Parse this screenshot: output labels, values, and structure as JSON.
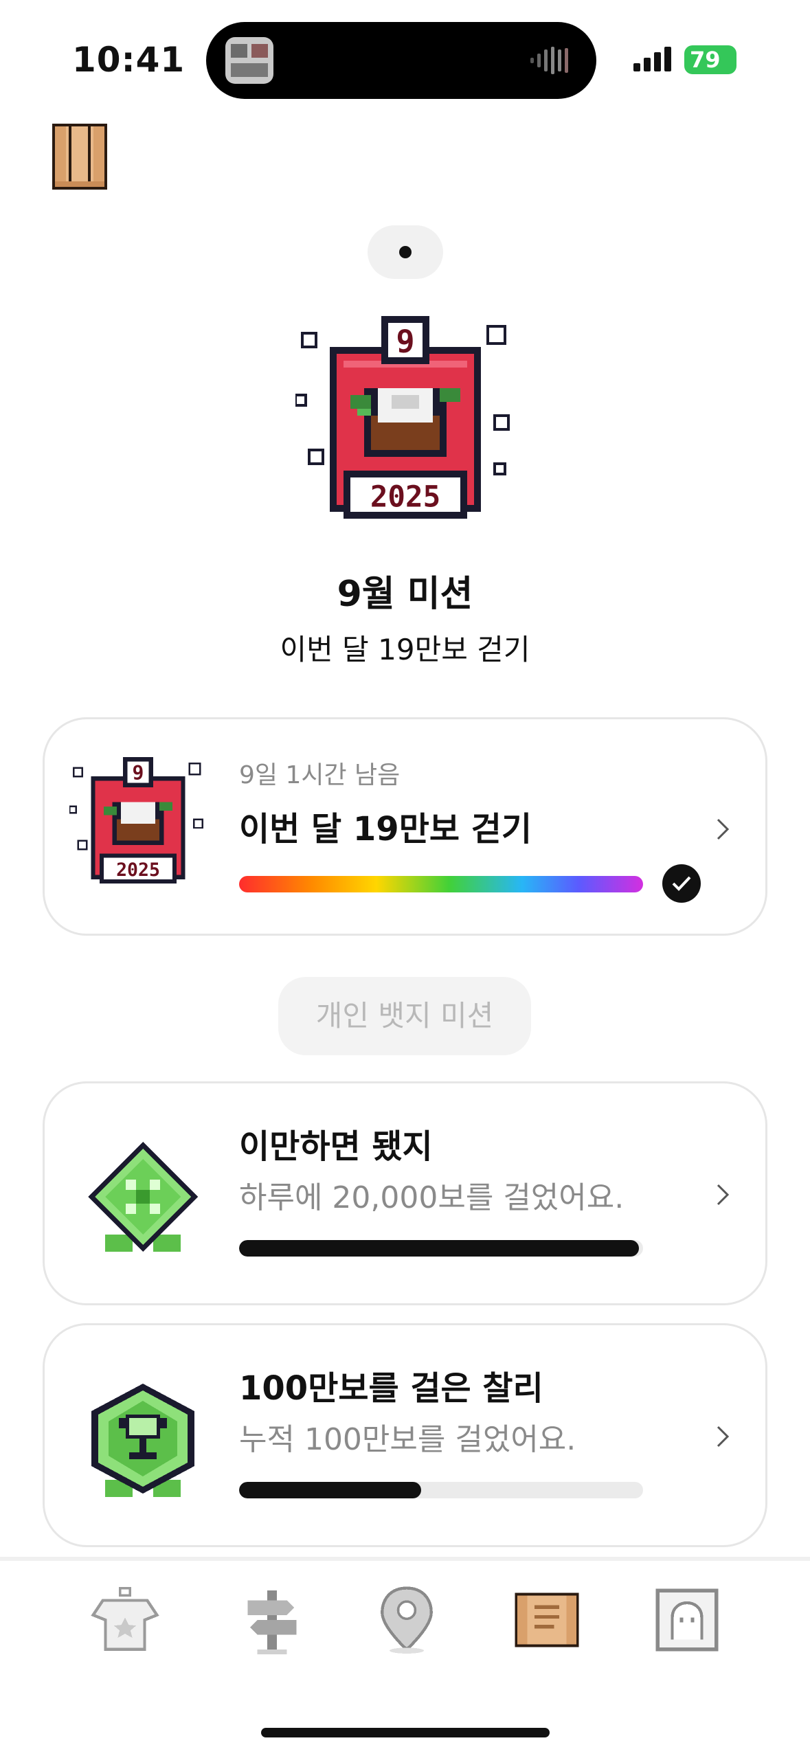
{
  "status_bar": {
    "time": "10:41",
    "battery": "79"
  },
  "hero": {
    "badge_number": "9",
    "badge_year": "2025",
    "title": "9월 미션",
    "subtitle": "이번 달 19만보 걷기"
  },
  "monthly_mission": {
    "remaining": "9일 1시간 남음",
    "title": "이번 달 19만보 걷기",
    "badge_number": "9",
    "badge_year": "2025",
    "progress": 1.0,
    "completed": true
  },
  "section_label": "개인 뱃지 미션",
  "badge_missions": [
    {
      "title": "이만하면 됐지",
      "description": "하루에 20,000보를 걸었어요.",
      "progress": 0.99,
      "icon": "green-diamond-badge-icon"
    },
    {
      "title": "100만보를 걸은 찰리",
      "description": "누적 100만보를 걸었어요.",
      "progress": 0.45,
      "icon": "trophy-hexagon-badge-icon"
    }
  ],
  "tabs": [
    {
      "icon": "shirt-icon"
    },
    {
      "icon": "signpost-icon"
    },
    {
      "icon": "map-pin-icon"
    },
    {
      "icon": "scroll-icon",
      "active": true
    },
    {
      "icon": "profile-frame-icon"
    }
  ],
  "colors": {
    "badge_red": "#e0334a",
    "badge_dark": "#6b0f1e",
    "accent_black": "#111111",
    "scroll_tan": "#e8b98a"
  }
}
